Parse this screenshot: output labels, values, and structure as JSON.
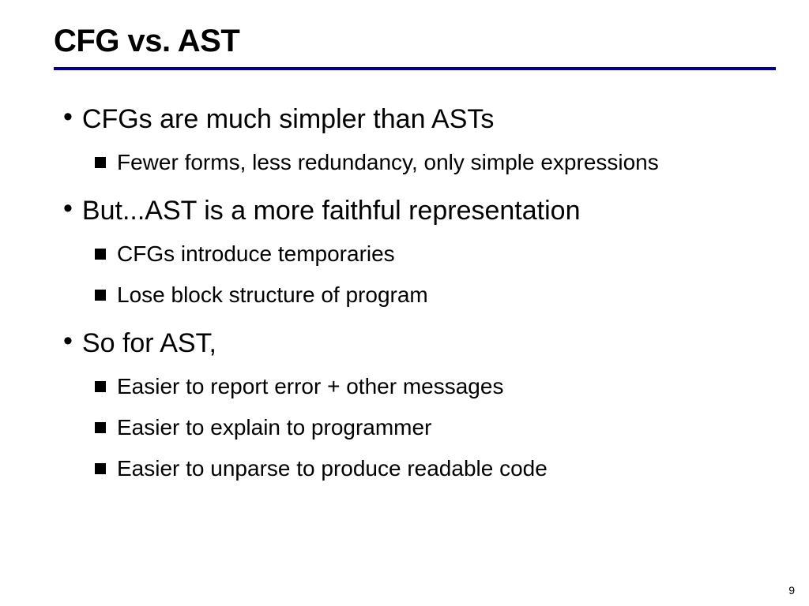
{
  "title": "CFG vs. AST",
  "bullets": {
    "b1": "CFGs are much simpler than ASTs",
    "b1a": "Fewer forms, less redundancy, only simple expressions",
    "b2": "But...AST is a more faithful representation",
    "b2a": "CFGs introduce temporaries",
    "b2b": "Lose block structure of program",
    "b3": "So for AST,",
    "b3a": "Easier to report error + other messages",
    "b3b": "Easier to explain to programmer",
    "b3c": "Easier to unparse to produce readable code"
  },
  "page_number": "9"
}
